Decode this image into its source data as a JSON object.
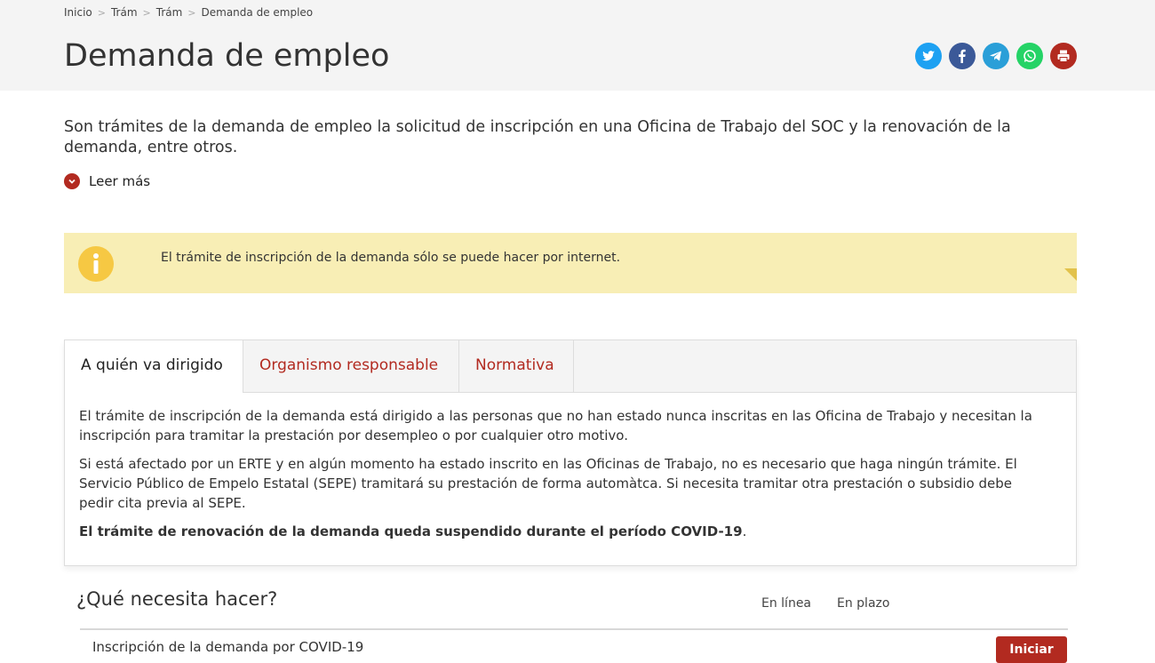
{
  "breadcrumb": {
    "items": [
      "Inicio",
      "Trám",
      "Trám",
      "Demanda de empleo"
    ]
  },
  "page": {
    "title": "Demanda de empleo",
    "intro": "Son trámites de la demanda de empleo la solicitud de inscripción en una Oficina de Trabajo del SOC y la renovación de la demanda, entre otros.",
    "read_more": "Leer más"
  },
  "share": {
    "icons": [
      "twitter-icon",
      "facebook-icon",
      "telegram-icon",
      "whatsapp-icon",
      "print-icon"
    ],
    "colors": {
      "twitter": "#1da1f2",
      "facebook": "#3b5998",
      "telegram": "#2a9fd8",
      "whatsapp": "#25d366",
      "print": "#b22a20"
    }
  },
  "alert": {
    "text": "El trámite de inscripción de la demanda sólo se puede hacer por internet."
  },
  "tabs": {
    "items": [
      "A quién va dirigido",
      "Organismo responsable",
      "Normativa"
    ],
    "content": {
      "p1": "El trámite de inscripción de la demanda está dirigido a las personas que no han estado nunca inscritas en las Oficina de Trabajo y necesitan la inscripción para tramitar la prestación por desempleo o por cualquier otro motivo.",
      "p2": "Si está afectado por un ERTE y en algún momento ha estado inscrito en las Oficinas de Trabajo, no es necesario que haga ningún trámite. El Servicio Público de Empelo Estatal (SEPE) tramitará su prestación de forma automàtca. Si necesita tramitar otra prestación o subsidio debe pedir cita previa al SEPE.",
      "p3_bold": "El trámite de renovación de la demanda queda suspendido durante el período COVID-19",
      "p3_end": "."
    }
  },
  "need": {
    "title": "¿Qué necesita hacer?",
    "col_online": "En línea",
    "col_deadline": "En plazo",
    "row_text": "Inscripción de la demanda por COVID-19",
    "row_button": "Iniciar"
  },
  "colors": {
    "accent": "#b22a20",
    "alert_bg": "#f8eeb5",
    "header_bg": "#f4f4f4"
  }
}
